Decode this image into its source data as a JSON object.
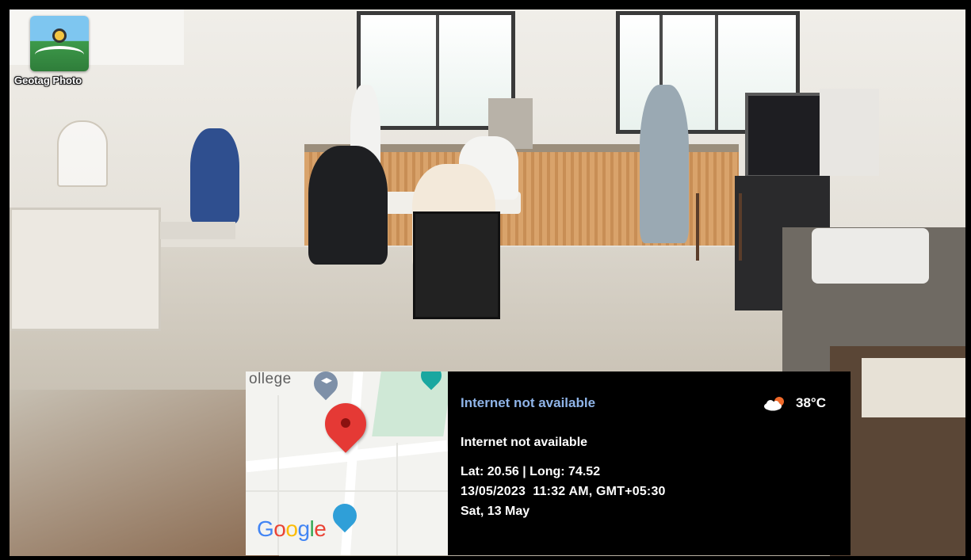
{
  "app": {
    "name": "Geotag Photo",
    "logo_icon": "geotag-photo-app-icon"
  },
  "map": {
    "place_label": "ollege",
    "provider": "Google",
    "marker_icon": "red-location-pin-icon",
    "poi_icon": "school-cap-pin-icon",
    "colors": {
      "marker": "#e53935",
      "park": "#cfe8d6",
      "poi": "#7e90a8"
    }
  },
  "info": {
    "title": "Internet not available",
    "address": "Internet not available",
    "lat_long": "Lat: 20.56 | Long: 74.52",
    "datetime": "13/05/2023  11:32 AM, GMT+05:30",
    "day": "Sat, 13 May",
    "weather_icon": "partly-cloudy-sun-icon",
    "temperature": "38°C",
    "colors": {
      "title": "#8fb4e8",
      "panel": "#000000",
      "text": "#ffffff"
    }
  }
}
